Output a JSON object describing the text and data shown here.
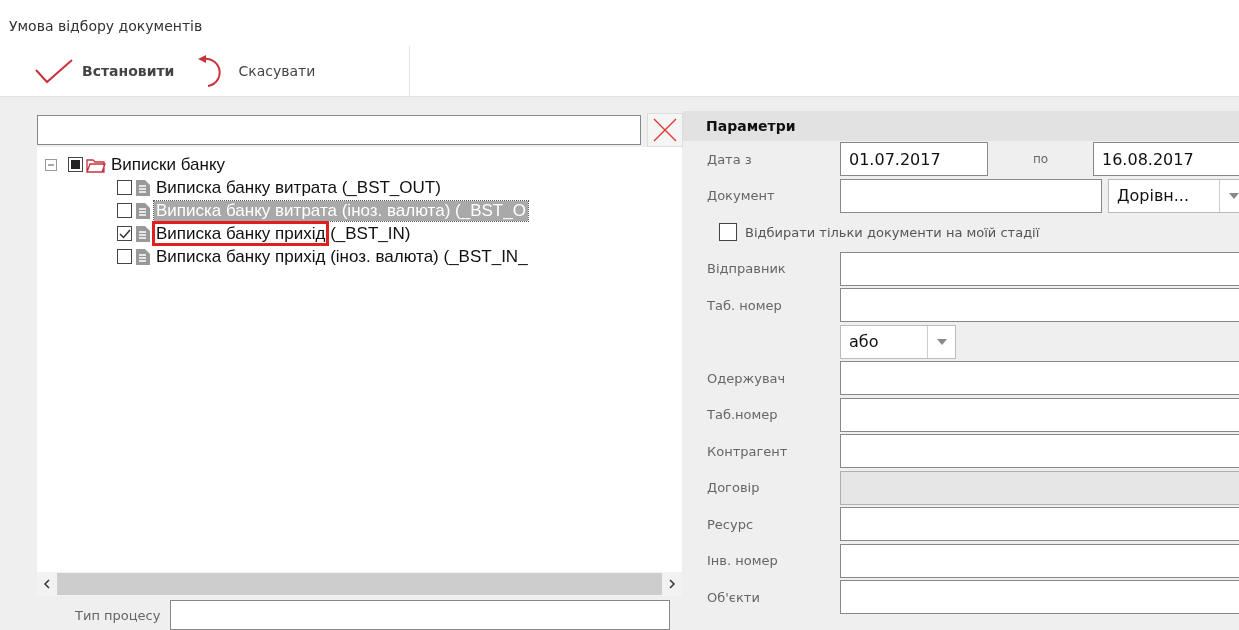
{
  "window": {
    "title": "Умова відбору документів"
  },
  "toolbar": [
    {
      "kind": "apply",
      "label": "Встановити"
    },
    {
      "kind": "cancel",
      "label": "Скасувати"
    }
  ],
  "tree": {
    "root": {
      "label": "Виписки банку",
      "expanded": true,
      "indeterminate": true,
      "children": [
        {
          "label": "Виписка банку витрата (_BST_OUT)",
          "checked": false,
          "selected": false,
          "highlighted": false
        },
        {
          "label": "Виписка банку витрата (іноз. валюта) (_BST_O",
          "checked": false,
          "selected": true,
          "highlighted": false
        },
        {
          "label": "Виписка банку прихід",
          "suffix": " (_BST_IN)",
          "checked": true,
          "selected": false,
          "highlighted": true
        },
        {
          "label": "Виписка банку прихід (іноз. валюта) (_BST_IN_",
          "checked": false,
          "selected": false,
          "highlighted": false
        }
      ]
    },
    "process_type": {
      "label": "Тип процесу"
    }
  },
  "parameters": {
    "title": "Параметри",
    "rows": [
      {
        "kind": "date_range",
        "label": "Дата з",
        "from": "01.07.2017",
        "separator": "по",
        "to": "16.08.2017"
      },
      {
        "kind": "text_select",
        "label": "Документ",
        "option": "Дорівн..."
      },
      {
        "kind": "checkbox",
        "label": "Відбирати тільки документи на моїй стадії",
        "checked": false
      },
      {
        "kind": "text",
        "label": "Відправник",
        "disabled": false
      },
      {
        "kind": "text",
        "label": "Таб. номер",
        "disabled": false
      },
      {
        "kind": "select",
        "option": "або"
      },
      {
        "kind": "text",
        "label": "Одержувач",
        "disabled": false
      },
      {
        "kind": "text",
        "label": "Таб.номер",
        "disabled": false
      },
      {
        "kind": "text",
        "label": "Контрагент",
        "disabled": false
      },
      {
        "kind": "text",
        "label": "Договір",
        "disabled": true
      },
      {
        "kind": "text",
        "label": "Ресурс",
        "disabled": false
      },
      {
        "kind": "text",
        "label": "Інв. номер",
        "disabled": false
      },
      {
        "kind": "text",
        "label": "Об'єкти",
        "disabled": false
      }
    ]
  }
}
